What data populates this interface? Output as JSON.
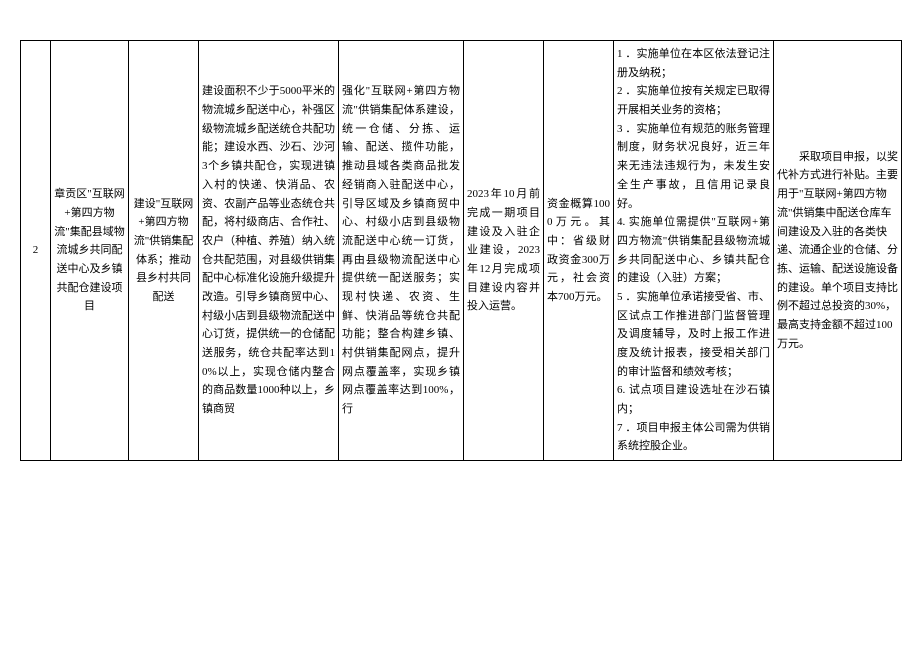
{
  "row": {
    "num": "2",
    "name": "章贡区\"互联网+第四方物流\"集配县域物流城乡共同配送中心及乡镇共配仓建设项目",
    "build": "建设\"互联网+第四方物流\"供销集配体系；推动县乡村共同配送",
    "content": "建设面积不少于5000平米的物流城乡配送中心，补强区级物流城乡配送统仓共配功能；建设水西、沙石、沙河3个乡镇共配仓，实现进镇入村的快递、快消品、农资、农副产品等业态统仓共配，将村级商店、合作社、农户（种植、养殖）纳入统仓共配范围，对县级供销集配中心标准化设施升级提升改造。引导乡镇商贸中心、村级小店到县级物流配送中心订货，提供统一的仓储配送服务，统仓共配率达到10%以上，实现仓储内整合的商品数量1000种以上，乡镇商贸",
    "strengthen": "强化\"互联网+第四方物流\"供销集配体系建设，统一仓储、分拣、运输、配送、揽件功能，推动县域各类商品批发经销商入驻配送中心，引导区域及乡镇商贸中心、村级小店到县级物流配送中心统一订货，再由县级物流配送中心提供统一配送服务；实现村快递、农资、生鲜、快消品等统仓共配功能；整合构建乡镇、村供销集配网点，提升网点覆盖率，实现乡镇网点覆盖率达到100%，行",
    "time": "2023年10月前完成一期项目建设及入驻企业建设，2023年12月完成项目建设内容并投入运营。",
    "fund": "资金概算1000万元。其中：省级财政资金300万元，社会资本700万元。",
    "requirements": "1 ．实施单位在本区依法登记注册及纳税；\n2 ．实施单位按有关规定已取得开展相关业务的资格；\n3 ．实施单位有规范的账务管理制度，财务状况良好，近三年来无违法违规行为，未发生安全生产事故，且信用记录良好。\n4. 实施单位需提供\"互联网+第四方物流\"供销集配县级物流城乡共同配送中心、乡镇共配仓的建设（入驻）方案；\n5 ．实施单位承诺接受省、市、区试点工作推进部门监督管理及调度辅导，及时上报工作进度及统计报表，接受相关部门的审计监督和绩效考核；\n6. 试点项目建设选址在沙石镇内；\n7 ．项目申报主体公司需为供销系统控股企业。",
    "subsidy": "　　采取项目申报，以奖代补方式进行补贴。主要用于\"互联网+第四方物流\"供销集中配送仓库车间建设及入驻的各类快递、流通企业的仓储、分拣、运输、配送设施设备的建设。单个项目支持比例不超过总投资的30%，最高支持金额不超过100万元。"
  }
}
